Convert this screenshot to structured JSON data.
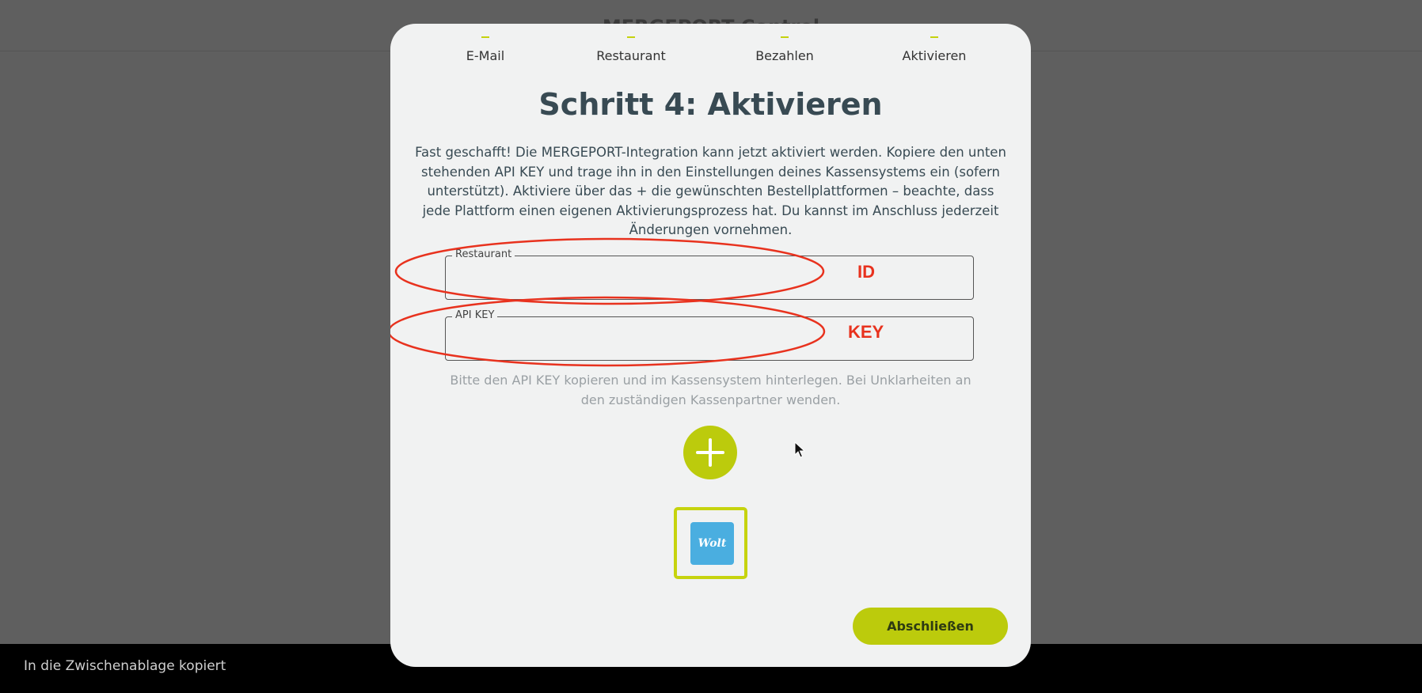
{
  "background": {
    "title": "MERGEPORT Control"
  },
  "steps": [
    {
      "label": "E-Mail"
    },
    {
      "label": "Restaurant"
    },
    {
      "label": "Bezahlen"
    },
    {
      "label": "Aktivieren"
    }
  ],
  "heading": "Schritt 4: Aktivieren",
  "description": "Fast geschafft! Die MERGEPORT-Integration kann jetzt aktiviert werden. Kopiere den unten stehenden API KEY und trage ihn in den Einstellungen deines Kassensystems ein (sofern unterstützt). Aktiviere über das + die gewünschten Bestellplattformen – beachte, dass jede Plattform einen eigenen Aktivierungsprozess hat. Du kannst im Anschluss jederzeit Änderungen vornehmen.",
  "fields": {
    "restaurant": {
      "legend": "Restaurant",
      "value": ""
    },
    "api_key": {
      "legend": "API KEY",
      "value": ""
    }
  },
  "annotations": {
    "id_label": "ID",
    "key_label": "KEY",
    "color": "#e8321e"
  },
  "hint": "Bitte den API KEY kopieren und im Kassensystem hinterlegen. Bei Unklarheiten an den zuständigen Kassenpartner wenden.",
  "add_button": {
    "icon": "plus-icon"
  },
  "platforms": [
    {
      "name": "Wolt",
      "color": "#4aaee0"
    }
  ],
  "finish_button": {
    "label": "Abschließen"
  },
  "snackbar": {
    "text": "In die Zwischenablage kopiert"
  },
  "colors": {
    "accent": "#bccb0c",
    "text": "#384a53",
    "modal_bg": "#f1f2f2"
  }
}
